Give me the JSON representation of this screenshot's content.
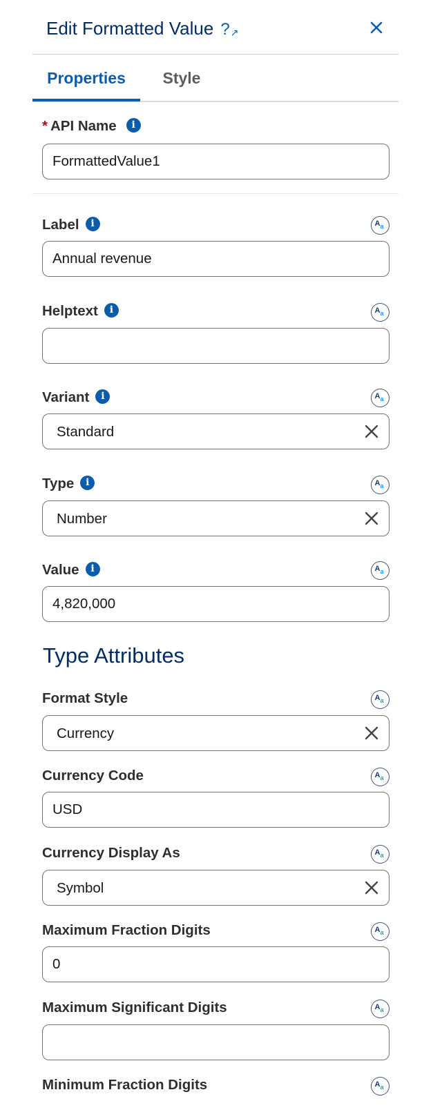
{
  "header": {
    "title": "Edit Formatted Value",
    "help_icon": "question-icon",
    "close_icon": "close-icon"
  },
  "tabs": [
    {
      "label": "Properties",
      "active": true
    },
    {
      "label": "Style",
      "active": false
    }
  ],
  "api_name": {
    "label": "API Name",
    "required_mark": "*",
    "value": "FormattedValue1"
  },
  "fields": {
    "label": {
      "label": "Label",
      "value": "Annual revenue"
    },
    "helptext": {
      "label": "Helptext",
      "value": ""
    },
    "variant": {
      "label": "Variant",
      "value": "Standard"
    },
    "type": {
      "label": "Type",
      "value": "Number"
    },
    "value": {
      "label": "Value",
      "value": "4,820,000"
    }
  },
  "type_attributes": {
    "title": "Type Attributes",
    "format_style": {
      "label": "Format Style",
      "value": "Currency"
    },
    "currency_code": {
      "label": "Currency Code",
      "value": "USD"
    },
    "currency_display_as": {
      "label": "Currency Display As",
      "value": "Symbol"
    },
    "max_fraction_digits": {
      "label": "Maximum Fraction Digits",
      "value": "0"
    },
    "max_significant_digits": {
      "label": "Maximum Significant Digits",
      "value": ""
    },
    "min_fraction_digits": {
      "label": "Minimum Fraction Digits"
    }
  },
  "icons": {
    "info": "info-icon",
    "merge_field": "resource-picker-icon",
    "clear": "clear-icon",
    "info_glyph": "i",
    "aa_big": "A",
    "aa_small": "a"
  },
  "colors": {
    "brand_blue": "#0b5cab",
    "title_navy": "#032d60",
    "required_red": "#ba0517",
    "border_gray": "#747474"
  }
}
